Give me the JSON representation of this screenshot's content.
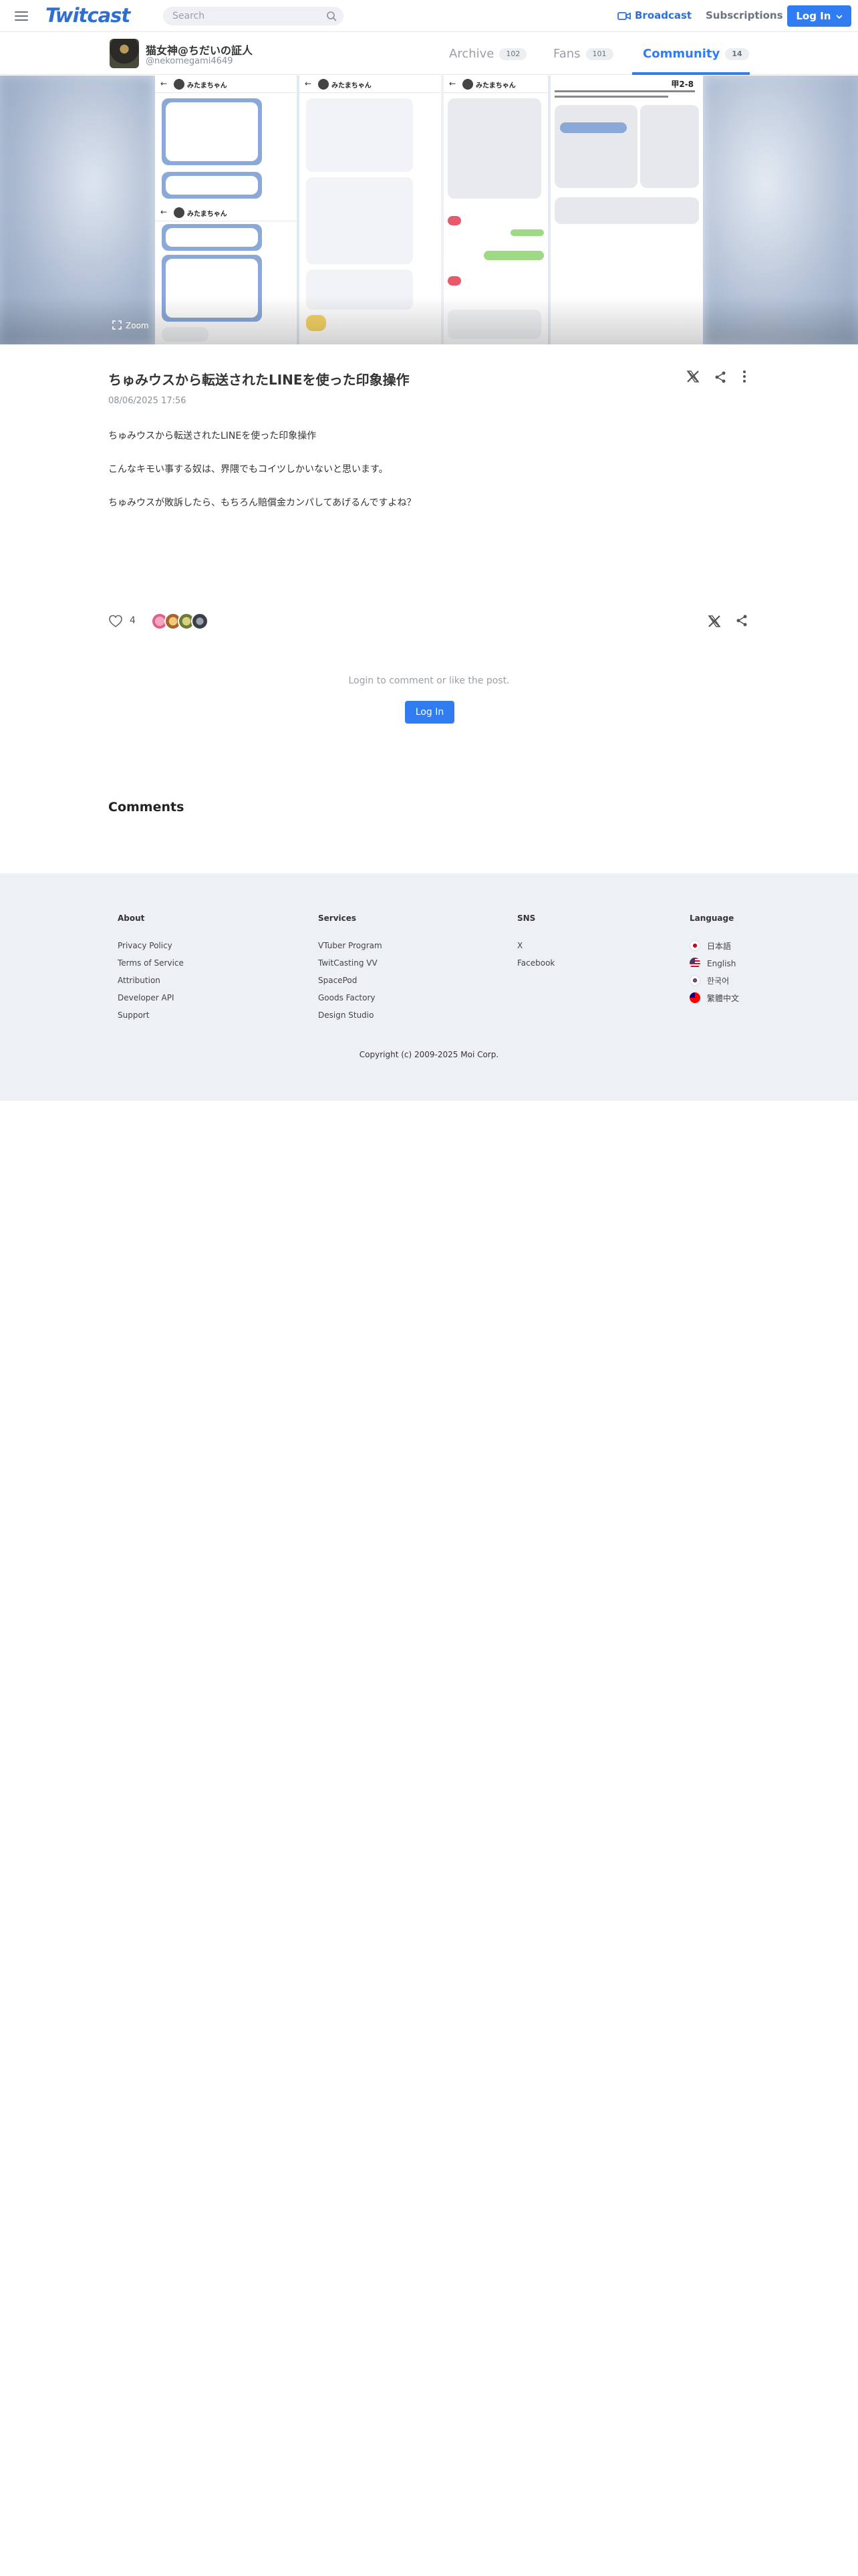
{
  "header": {
    "logo": "Twitcast",
    "search_placeholder": "Search",
    "broadcast": "Broadcast",
    "subscriptions": "Subscriptions",
    "login": "Log In"
  },
  "profile": {
    "name": "猫女神@ちだいの証人",
    "handle": "@nekomegami4649",
    "tabs": [
      {
        "label": "Archive",
        "count": "102"
      },
      {
        "label": "Fans",
        "count": "101"
      },
      {
        "label": "Community",
        "count": "14"
      }
    ],
    "active_tab": "Community"
  },
  "hero": {
    "shot1_name": "みたまちゃん",
    "shot2_name": "みたまちゃん",
    "shot3_name": "みたまちゃん",
    "shot4_label": "甲2-8",
    "zoom_label": "Zoom"
  },
  "post": {
    "title": "ちゅみウスから転送されたLINEを使った印象操作",
    "date": "08/06/2025 17:56",
    "body": [
      "ちゅみウスから転送されたLINEを使った印象操作",
      "こんなキモい事する奴は、界隈でもコイツしかいないと思います。",
      "ちゅみウスが敗訴したら、もちろん賠償金カンパしてあげるんですよね？"
    ],
    "likes": "4"
  },
  "login_prompt": "Login to comment or like the post.",
  "login_button": "Log In",
  "comments_heading": "Comments",
  "footer": {
    "about": {
      "heading": "About",
      "links": [
        "Privacy Policy",
        "Terms of Service",
        "Attribution",
        "Developer API",
        "Support"
      ]
    },
    "services": {
      "heading": "Services",
      "links": [
        "VTuber Program",
        "TwitCasting VV",
        "SpacePod",
        "Goods Factory",
        "Design Studio"
      ]
    },
    "sns": {
      "heading": "SNS",
      "links": [
        "X",
        "Facebook"
      ]
    },
    "language": {
      "heading": "Language",
      "links": [
        "日本語",
        "English",
        "한국어",
        "繁體中文"
      ]
    },
    "copyright": "Copyright (c) 2009-2025 Moi Corp."
  },
  "colors": {
    "accent": "#2f7df0",
    "footer_bg": "#edf0f5"
  }
}
